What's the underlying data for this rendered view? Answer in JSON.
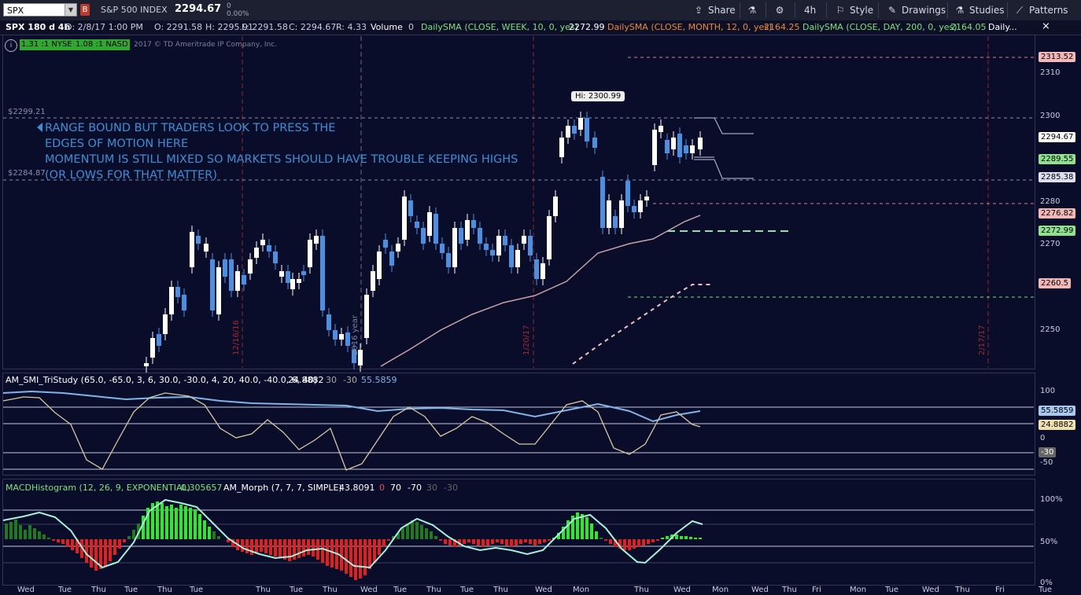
{
  "toolbar": {
    "symbol": "SPX",
    "index_name": "S&P 500 INDEX",
    "last_price": "2294.67",
    "change": "0",
    "change_pct": "0.00%",
    "flag": "B",
    "share_label": "Share",
    "timeframe": "4h",
    "style_label": "Style",
    "drawings_label": "Drawings",
    "studies_label": "Studies",
    "patterns_label": "Patterns"
  },
  "infobar": {
    "chart_id": "SPX 180 d 4h",
    "date": "D: 2/8/17 1:00 PM",
    "open": "O: 2291.58",
    "high": "H: 2295.91",
    "low": "L: 2291.58",
    "close": "C: 2294.67",
    "range": "R: 4.33",
    "volume_label": "Volume",
    "volume_value": "0",
    "sma_week": "DailySMA (CLOSE, WEEK, 10, 0, yes)",
    "sma_week_val": "2272.99",
    "sma_month": "DailySMA (CLOSE, MONTH, 12, 0, yes)",
    "sma_month_val": "2164.25",
    "sma_day": "DailySMA (CLOSE, DAY, 200, 0, yes)",
    "sma_day_val": "2164.05",
    "more": "Daily..."
  },
  "badges": {
    "nyse": "1.31 :1 NYSE",
    "nasd": "1.08 :1 NASD",
    "copyright": "2017 © TD Ameritrade IP Company, Inc."
  },
  "annotation": {
    "line1": "RANGE BOUND BUT TRADERS LOOK TO PRESS THE",
    "line2": "EDGES OF MOTION HERE",
    "line3": "MOMENTUM IS STILL MIXED SO MARKETS SHOULD HAVE TROUBLE KEEPING HIGHS",
    "line4": "(OR LOWS FOR THAT MATTER)"
  },
  "levels": {
    "upper": "2299.21",
    "lower": "2284.87",
    "hi_label": "Hi: 2300.99"
  },
  "price_axis": [
    "2310",
    "2300",
    "2290",
    "2280",
    "2270",
    "2260",
    "2250"
  ],
  "price_tags": [
    {
      "value": "2313.52",
      "color": "#f4b7b7"
    },
    {
      "value": "2294.67",
      "color": "#ffffff"
    },
    {
      "value": "2289.55",
      "color": "#8fe08f"
    },
    {
      "value": "2285.38",
      "color": "#dde0f0"
    },
    {
      "value": "2276.82",
      "color": "#f4b7b7"
    },
    {
      "value": "2272.99",
      "color": "#8fe08f"
    },
    {
      "value": "2260.5",
      "color": "#f4b7b7"
    }
  ],
  "vdates": [
    "12/16/16",
    "2016 year",
    "1/20/17",
    "2/17/17"
  ],
  "smi": {
    "label": "AM_SMI_TriStudy (65.0, -65.0, 3, 6, 30.0, -30.0, 4, 20, 40.0, -40.0, 6, 40)",
    "v1": "24.8882",
    "v2": "30",
    "v3": "-30",
    "v4": "55.5859",
    "axis": [
      "100",
      "50",
      "0",
      "-50"
    ],
    "tag_blue": "55.5859",
    "tag_tan": "24.8882",
    "tag_neg": "-30"
  },
  "macd": {
    "label": "MACDHistogram (12, 26, 9, EXPONENTIAL)",
    "value": "0.305657",
    "morph_label": "AM_Morph (7, 7, 7, SIMPLE)",
    "morph_value": "43.8091",
    "m1": "0",
    "m2": "70",
    "m3": "-70",
    "m4": "30",
    "m5": "-30",
    "axis": [
      "100%",
      "50%",
      "0%"
    ]
  },
  "dates": [
    "Wed",
    "Tue",
    "Thu",
    "Tue",
    "Thu",
    "Tue",
    "Thu",
    "Tue",
    "Thu",
    "Wed",
    "Tue",
    "Thu",
    "Tue",
    "Thu",
    "Wed",
    "Mon",
    "Thu",
    "Wed",
    "Mon",
    "Wed",
    "Thu",
    "Fri",
    "Mon",
    "Tue",
    "Wed",
    "Thu",
    "Fri",
    "Tue"
  ]
}
